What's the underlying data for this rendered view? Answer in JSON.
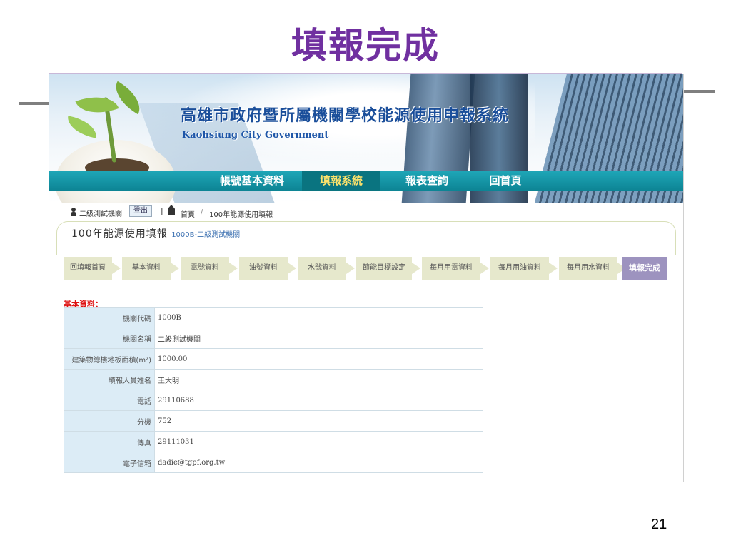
{
  "slide": {
    "title": "填報完成",
    "page_number": "21"
  },
  "banner": {
    "system_title": "高雄市政府暨所屬機關學校能源使用申報系統",
    "system_subtitle": "Kaohsiung City Government"
  },
  "nav": {
    "items": [
      {
        "label": "帳號基本資料"
      },
      {
        "label": "填報系統"
      },
      {
        "label": "報表查詢"
      },
      {
        "label": "回首頁"
      }
    ],
    "active_index": 1
  },
  "user_bar": {
    "user": "二級測試機關",
    "logout": "登出",
    "separator": "|",
    "breadcrumb_home": "首頁",
    "breadcrumb_sep": "/",
    "breadcrumb_current": "100年能源使用填報"
  },
  "panel": {
    "title": "100年能源使用填報",
    "subtitle": "1000B-二級測試機關"
  },
  "steps": [
    {
      "label": "回填報首頁"
    },
    {
      "label": "基本資料"
    },
    {
      "label": "電號資料"
    },
    {
      "label": "油號資料"
    },
    {
      "label": "水號資料"
    },
    {
      "label": "節能目標設定"
    },
    {
      "label": "每月用電資料"
    },
    {
      "label": "每月用油資料"
    },
    {
      "label": "每月用水資料"
    },
    {
      "label": "填報完成"
    }
  ],
  "basic_info": {
    "section_label": "基本資料：",
    "rows": [
      {
        "label": "機關代碼",
        "value": "1000B"
      },
      {
        "label": "機關名稱",
        "value": "二級測試機關"
      },
      {
        "label": "建築物總樓地板面積(m²)",
        "value": "1000.00"
      },
      {
        "label": "填報人員姓名",
        "value": "王大明"
      },
      {
        "label": "電話",
        "value": "29110688"
      },
      {
        "label": "分機",
        "value": "752"
      },
      {
        "label": "傳真",
        "value": "29111031"
      },
      {
        "label": "電子信箱",
        "value": "dadie@tgpf.org.tw"
      }
    ]
  },
  "colors": {
    "title_purple": "#7030a0",
    "nav_teal": "#0d8494",
    "active_step": "#9d93bf"
  }
}
